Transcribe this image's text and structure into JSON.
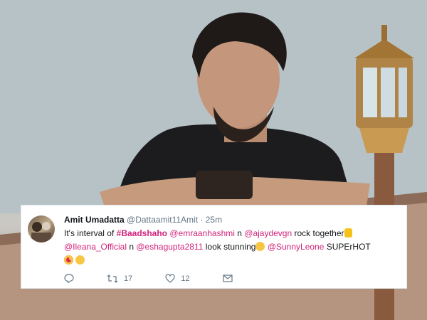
{
  "tweet": {
    "author_name": "Amit Umadatta",
    "author_handle": "@Dattaamit11Amit",
    "separator": "·",
    "time": "25m",
    "text": {
      "t1": "It's interval of ",
      "hashtag": "#Baadshaho",
      "t2": " ",
      "m1": "@emraanhashmi",
      "t3": " n ",
      "m2": "@ajaydevgn",
      "t4": " rock together",
      "m3": "@Ileana_Official",
      "t5": " n ",
      "m4": "@eshagupta2811",
      "t6": " look stunning",
      "t7": " ",
      "m5": "@SunnyLeone",
      "t8": " SUPErHOT"
    },
    "emojis": [
      "thumbs-up-icon",
      "kiss-face-icon",
      "heart-eyes-icon",
      "kiss-face-icon"
    ],
    "actions": {
      "reply_icon": "reply-icon",
      "retweet_count": "17",
      "like_count": "12",
      "dm_icon": "message-icon"
    },
    "colors": {
      "link": "#d2237b",
      "meta": "#657786",
      "text": "#14171a"
    }
  }
}
